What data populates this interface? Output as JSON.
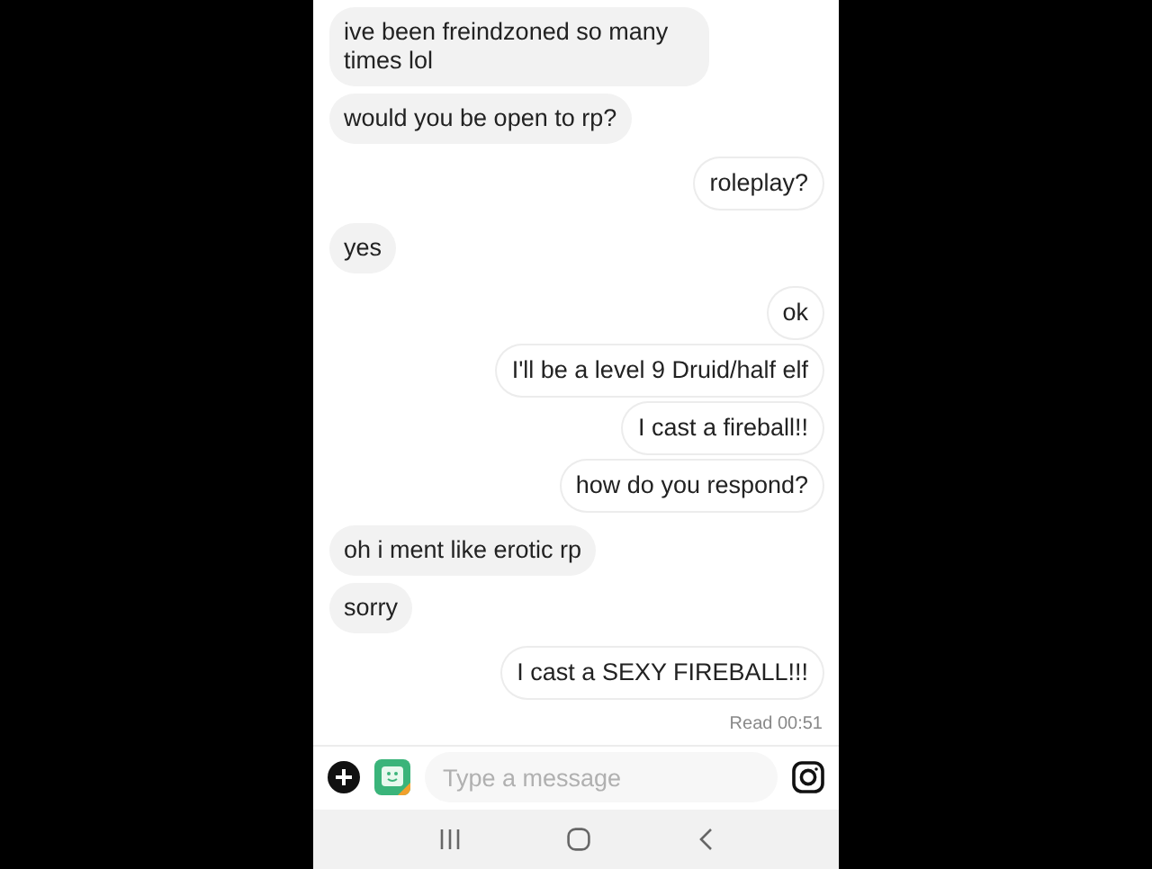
{
  "messages": [
    {
      "kind": "received",
      "text": "ive been freindzoned so many times lol"
    },
    {
      "kind": "received",
      "text": "would you be open to rp?"
    },
    {
      "kind": "sent",
      "text": "roleplay?"
    },
    {
      "kind": "received",
      "text": "yes"
    },
    {
      "kind": "sent",
      "text": "ok"
    },
    {
      "kind": "sent",
      "text": "I'll be a level 9 Druid/half elf"
    },
    {
      "kind": "sent",
      "text": "I cast a fireball!!"
    },
    {
      "kind": "sent",
      "text": "how do you respond?"
    },
    {
      "kind": "received",
      "text": "oh i ment like erotic rp"
    },
    {
      "kind": "received",
      "text": "sorry"
    },
    {
      "kind": "sent",
      "text": "I cast a SEXY FIREBALL!!!"
    }
  ],
  "receipt": "Read 00:51",
  "composer": {
    "placeholder": "Type a message"
  }
}
